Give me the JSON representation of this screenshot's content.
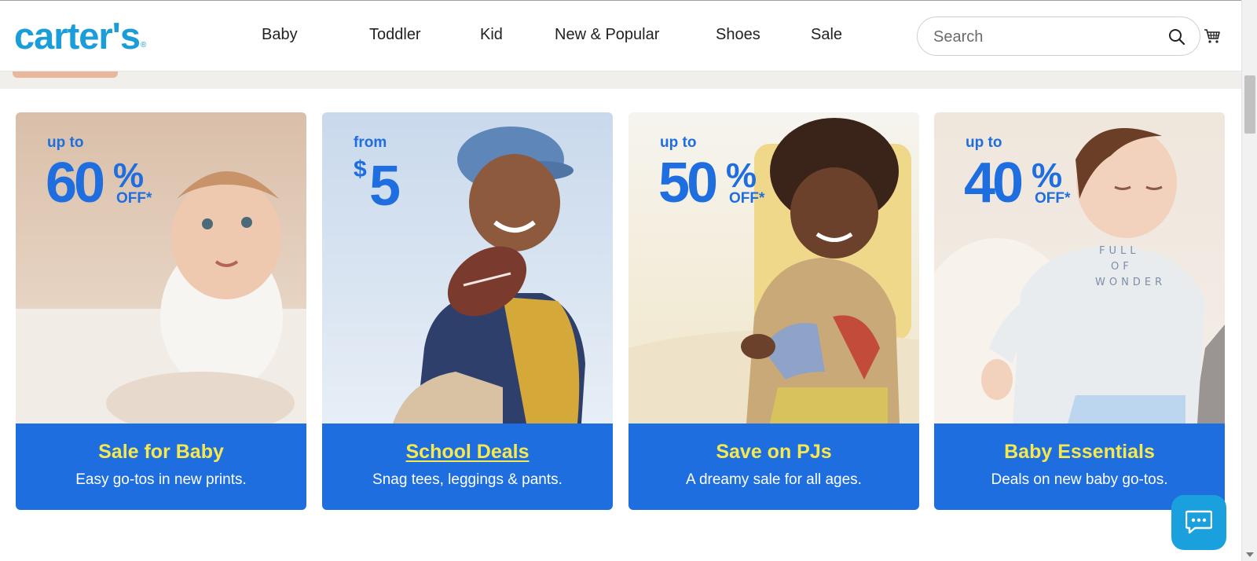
{
  "header": {
    "logo": "carter's",
    "logo_mark": "®",
    "nav": [
      "Baby",
      "Toddler",
      "Kid",
      "New & Popular",
      "Shoes",
      "Sale"
    ],
    "search_placeholder": "Search",
    "icons": {
      "search": "search-icon",
      "cart": "cart-icon"
    }
  },
  "cards": [
    {
      "promo_prefix": "up to",
      "promo_value": "60",
      "promo_suffix": "%",
      "promo_off": "OFF*",
      "title": "Sale for Baby",
      "subtitle": "Easy go-tos in new prints."
    },
    {
      "promo_prefix": "from",
      "promo_currency": "$",
      "promo_value": "5",
      "title": "School Deals",
      "subtitle": "Snag tees, leggings & pants."
    },
    {
      "promo_prefix": "up to",
      "promo_value": "50",
      "promo_suffix": "%",
      "promo_off": "OFF*",
      "title": "Save on PJs",
      "subtitle": "A dreamy sale for all ages."
    },
    {
      "promo_prefix": "up to",
      "promo_value": "40",
      "promo_suffix": "%",
      "promo_off": "OFF*",
      "title": "Baby Essentials",
      "subtitle": "Deals on new baby go-tos."
    }
  ],
  "colors": {
    "brand": "#1b9dd9",
    "panel": "#1e6ee0",
    "title": "#f6e84f",
    "chat": "#1aa0dc"
  },
  "chat": {
    "icon": "chat-icon"
  }
}
